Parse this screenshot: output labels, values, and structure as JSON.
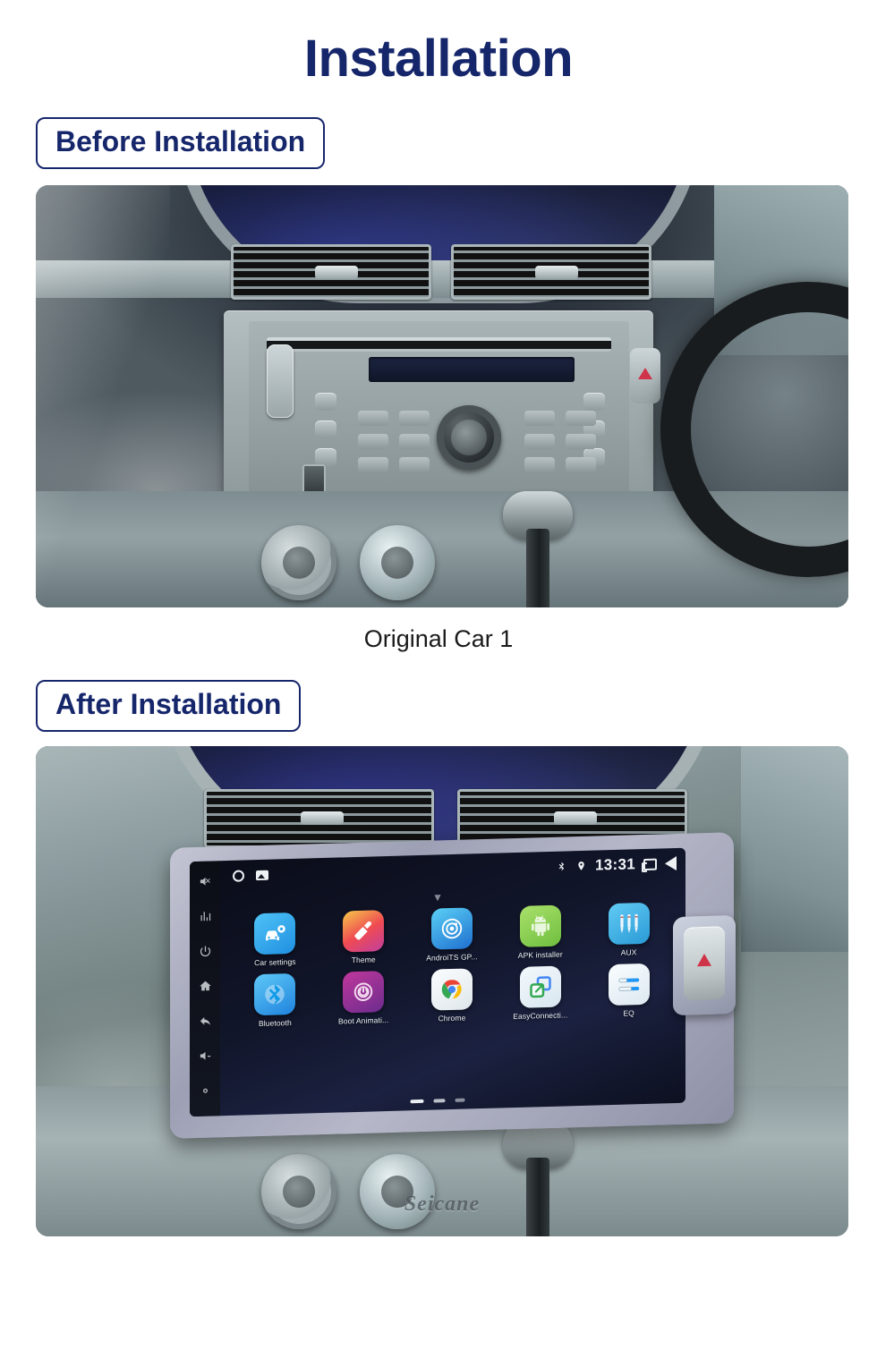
{
  "page": {
    "title": "Installation"
  },
  "sections": {
    "before": {
      "label": "Before Installation",
      "caption": "Original Car  1"
    },
    "after": {
      "label": "After Installation",
      "watermark": "Seicane"
    }
  },
  "head_unit": {
    "status_bar": {
      "time": "13:31",
      "icons": [
        "bluetooth-icon",
        "location-icon",
        "recents-icon",
        "back-icon"
      ],
      "left_icons": [
        "circle-icon",
        "photo-icon"
      ]
    },
    "side_buttons": [
      "mute-icon",
      "eq-icon",
      "power-icon",
      "home-icon",
      "back-icon",
      "volume-down-icon",
      "settings-icon"
    ],
    "apps": [
      {
        "label": "Car settings",
        "icon": "car-settings-icon",
        "color": "#2f9ee8"
      },
      {
        "label": "Theme",
        "icon": "theme-brush-icon",
        "color": "#ef4b52"
      },
      {
        "label": "AndroiTS GP...",
        "icon": "gps-radar-icon",
        "color": "#2d8fe0"
      },
      {
        "label": "APK installer",
        "icon": "android-robot-icon",
        "color": "#8ed14f"
      },
      {
        "label": "AUX",
        "icon": "aux-jacks-icon",
        "color": "#49b6ef"
      },
      {
        "label": "Bluetooth",
        "icon": "bluetooth-icon",
        "color": "#2a93e8"
      },
      {
        "label": "Boot Animati...",
        "icon": "power-circle-icon",
        "color": "#c0379c"
      },
      {
        "label": "Chrome",
        "icon": "chrome-icon",
        "color": "#f1f4f6"
      },
      {
        "label": "EasyConnecti...",
        "icon": "screen-share-icon",
        "color": "#e8f1f7"
      },
      {
        "label": "EQ",
        "icon": "equalizer-icon",
        "color": "#eef3f7"
      }
    ],
    "page_indicator": {
      "pages": 3,
      "active": 1
    }
  },
  "theme": {
    "accent": "#16266b",
    "background": "#ffffff",
    "caption_color": "#1a1a1a"
  }
}
